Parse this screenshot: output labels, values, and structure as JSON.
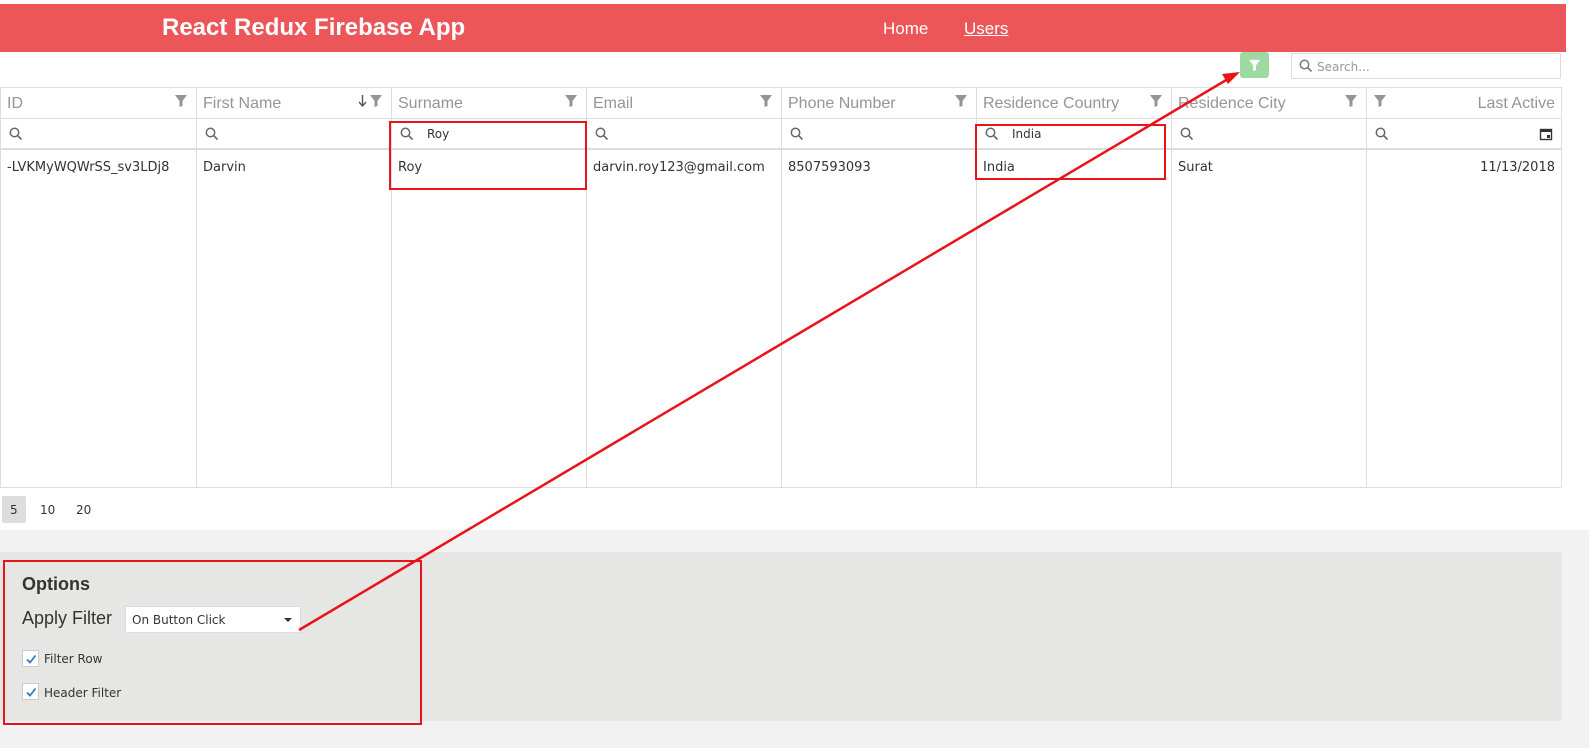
{
  "header": {
    "brand": "React Redux Firebase App",
    "nav": [
      {
        "label": "Home"
      },
      {
        "label": "Users"
      }
    ]
  },
  "toolbar": {
    "search_placeholder": "Search..."
  },
  "grid": {
    "columns": [
      {
        "label": "ID",
        "filter_value": "",
        "sorted": false
      },
      {
        "label": "First Name",
        "filter_value": "",
        "sorted": true
      },
      {
        "label": "Surname",
        "filter_value": "Roy",
        "sorted": false
      },
      {
        "label": "Email",
        "filter_value": "",
        "sorted": false
      },
      {
        "label": "Phone Number",
        "filter_value": "",
        "sorted": false
      },
      {
        "label": "Residence Country",
        "filter_value": "India",
        "sorted": false
      },
      {
        "label": "Residence City",
        "filter_value": "",
        "sorted": false
      },
      {
        "label": "Last Active",
        "filter_value": "",
        "sorted": false
      }
    ],
    "rows": [
      [
        "-LVKMyWQWrSS_sv3LDj8",
        "Darvin",
        "Roy",
        "darvin.roy123@gmail.com",
        "8507593093",
        "India",
        "Surat",
        "11/13/2018"
      ]
    ]
  },
  "pager": {
    "sizes": [
      "5",
      "10",
      "20"
    ],
    "active_size": "5"
  },
  "options": {
    "title": "Options",
    "apply_filter_label": "Apply Filter",
    "apply_filter_value": "On Button Click",
    "checkboxes": [
      {
        "label": "Filter Row",
        "checked": true
      },
      {
        "label": "Header Filter",
        "checked": true
      }
    ]
  },
  "colors": {
    "header_bg": "#ec5659",
    "apply_button": "#9fd9a2",
    "annotation": "#e8141a"
  },
  "icons": [
    "filter-icon",
    "sort-desc-icon",
    "search-icon",
    "calendar-icon",
    "check-icon",
    "caret-down-icon"
  ]
}
